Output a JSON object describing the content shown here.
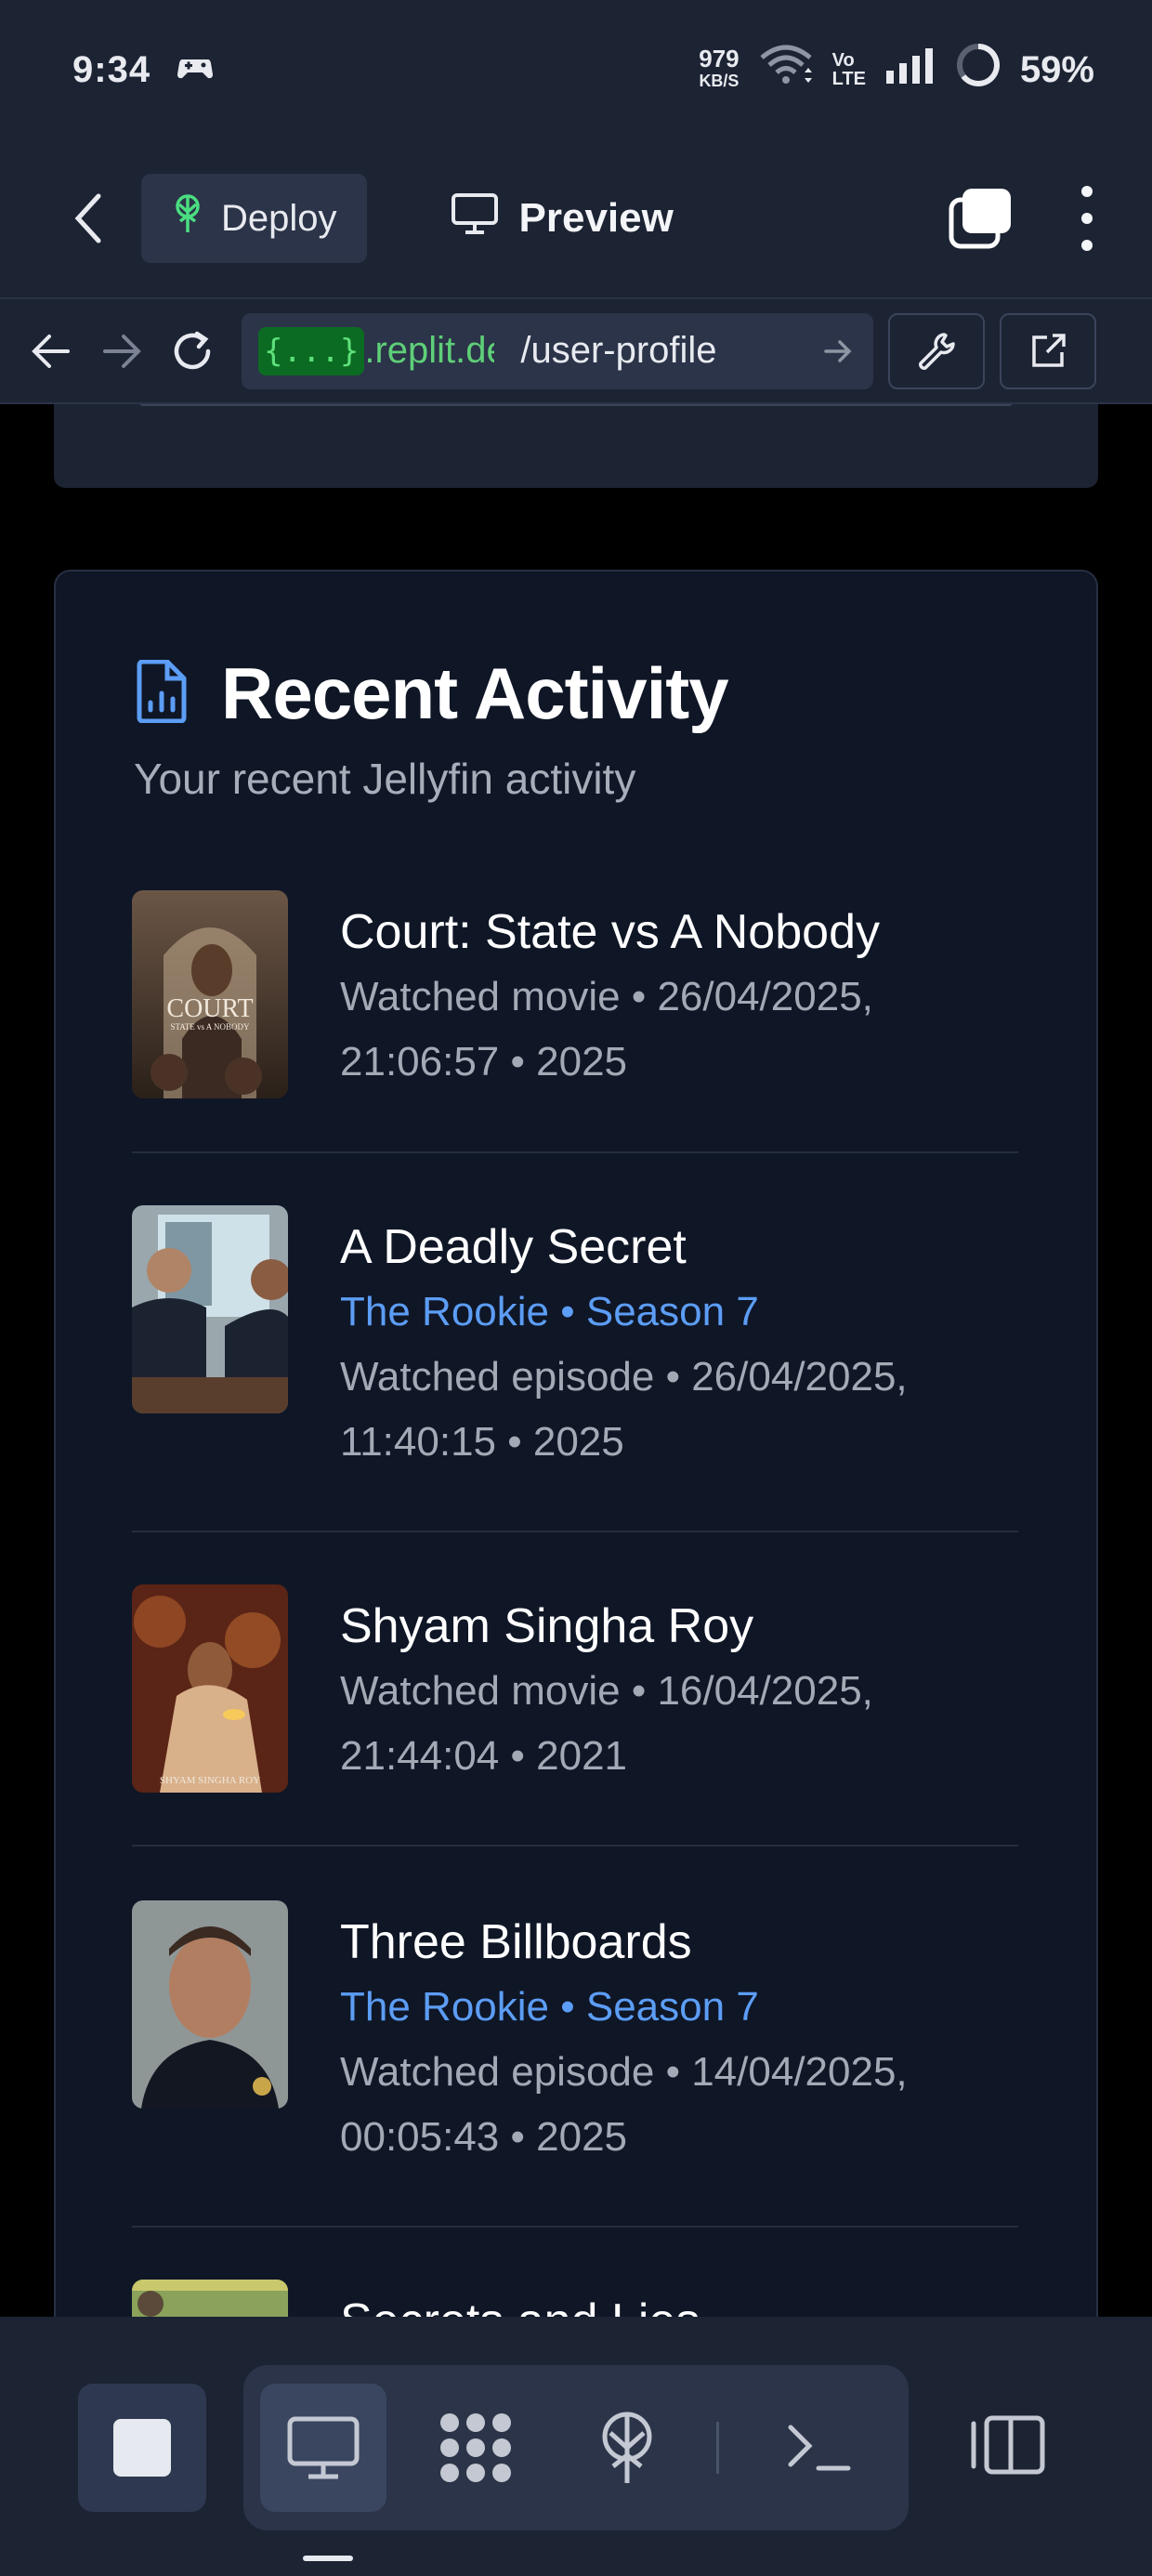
{
  "status_bar": {
    "time": "9:34",
    "net_speed_value": "979",
    "net_speed_unit": "KB/S",
    "volte_top": "Vo",
    "volte_bottom": "LTE",
    "battery": "59%"
  },
  "app_bar": {
    "deploy_label": "Deploy",
    "preview_label": "Preview"
  },
  "url_bar": {
    "chip": "{...}",
    "host": ".replit.dev",
    "path": "/user-profile"
  },
  "activity": {
    "title": "Recent Activity",
    "subtitle": "Your recent Jellyfin activity",
    "items": [
      {
        "title": "Court: State vs A Nobody",
        "series": "",
        "meta_line1": "Watched movie • 26/04/2025,",
        "meta_line2": "21:06:57 • 2025",
        "poster_text_top": "COURT",
        "poster_text_bottom": "STATE vs A NOBODY"
      },
      {
        "title": "A Deadly Secret",
        "series": "The Rookie • Season 7",
        "meta_line1": "Watched episode • 26/04/2025,",
        "meta_line2": "11:40:15 • 2025"
      },
      {
        "title": "Shyam Singha Roy",
        "series": "",
        "meta_line1": "Watched movie • 16/04/2025,",
        "meta_line2": "21:44:04 • 2021",
        "poster_text_bottom": "SHYAM SINGHA ROY"
      },
      {
        "title": "Three Billboards",
        "series": "The Rookie • Season 7",
        "meta_line1": "Watched episode • 14/04/2025,",
        "meta_line2": "00:05:43 • 2025"
      },
      {
        "title": "Secrets and Lies"
      }
    ]
  },
  "colors": {
    "background": "#000000",
    "surface": "#1c2333",
    "card": "#0f1626",
    "accent_blue": "#5c9df5",
    "url_green": "#5fcf78"
  },
  "icons": {
    "back": "chevron-left-icon",
    "deploy": "deploy-icon",
    "preview": "monitor-icon",
    "tabs": "tabs-icon",
    "more": "more-vertical-icon",
    "nav_back": "arrow-left-icon",
    "nav_forward": "arrow-right-icon",
    "reload": "reload-icon",
    "wrench": "wrench-icon",
    "external": "external-link-icon",
    "activity": "file-chart-icon"
  }
}
